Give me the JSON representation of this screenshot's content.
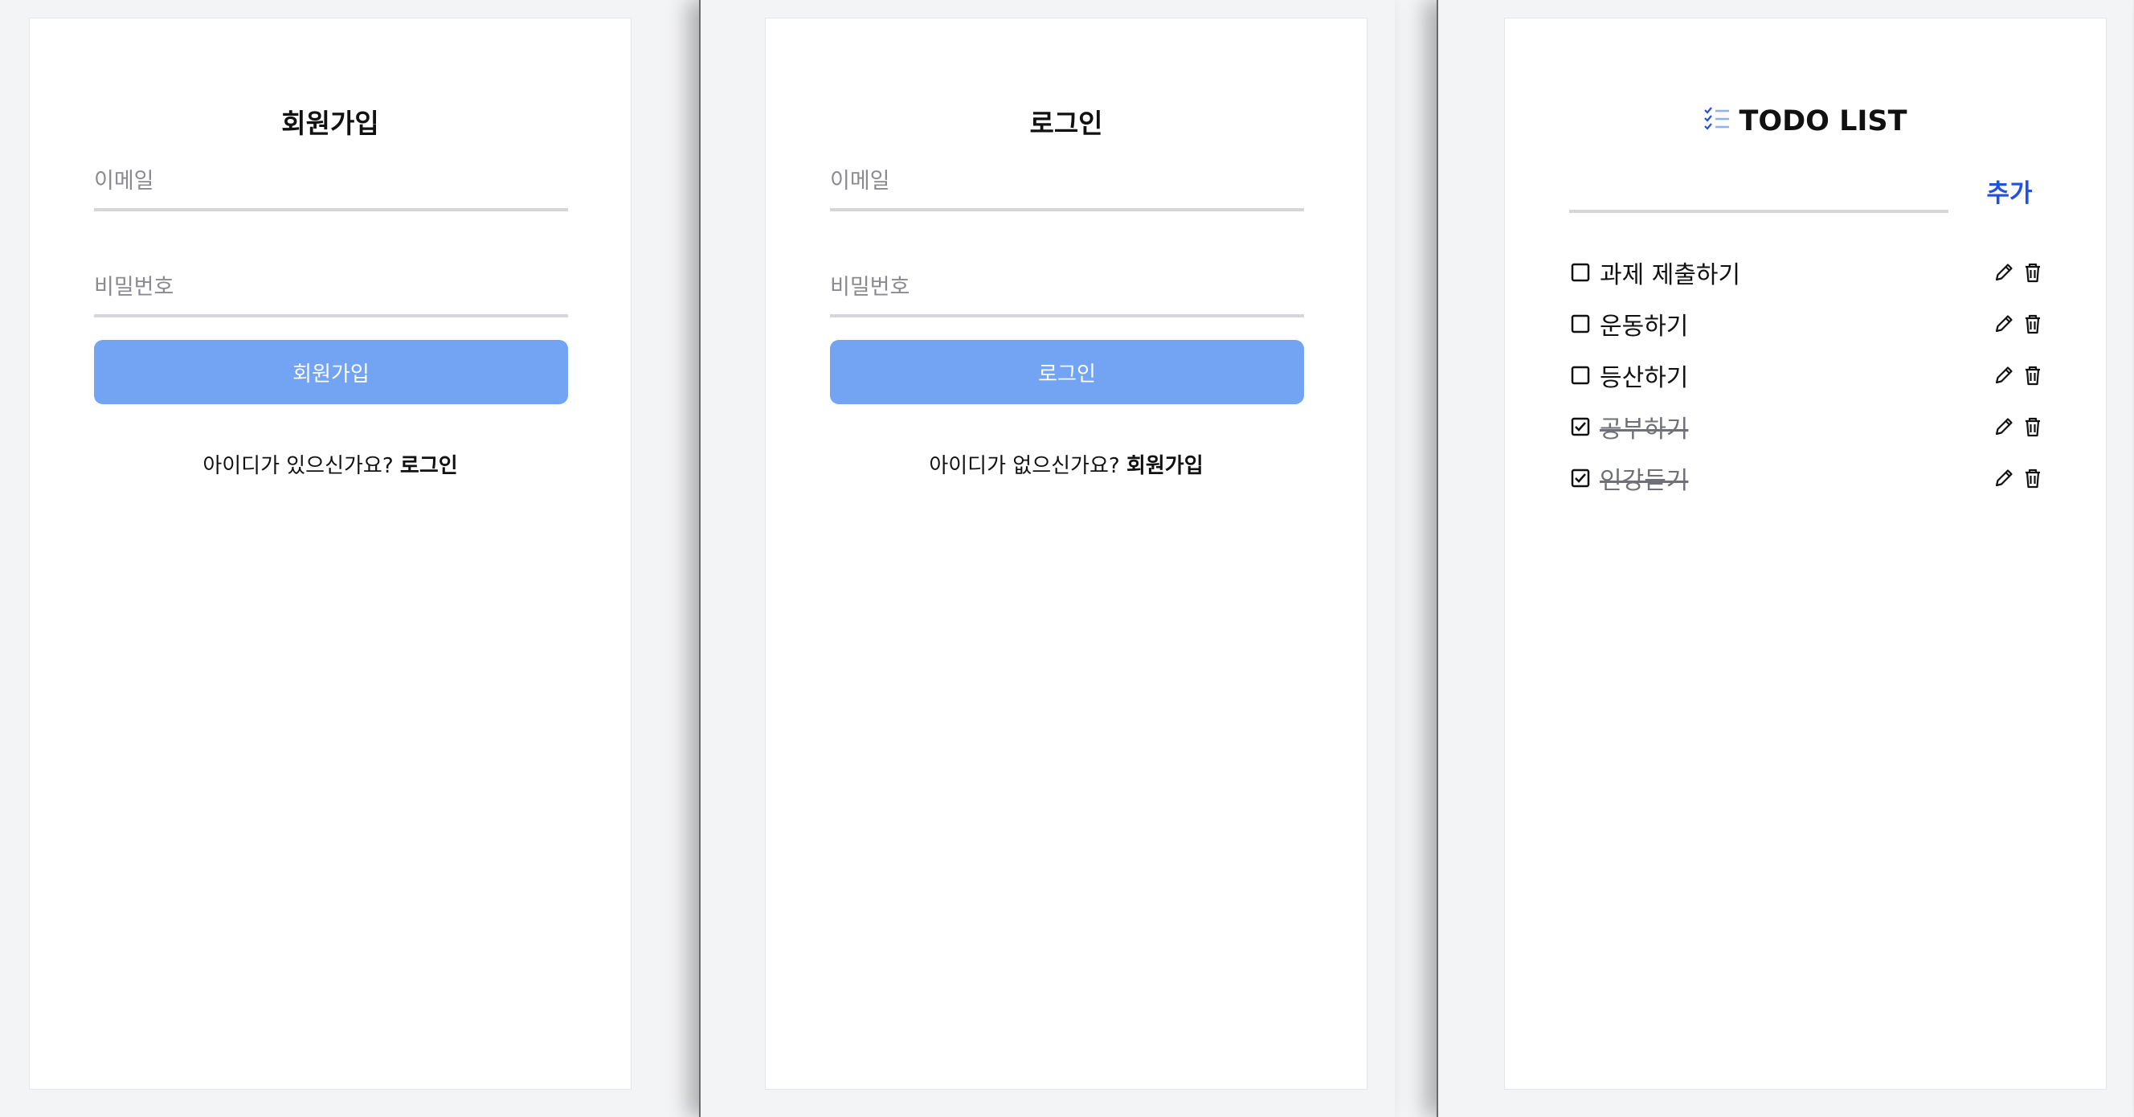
{
  "signup": {
    "title": "회원가입",
    "email_placeholder": "이메일",
    "password_placeholder": "비밀번호",
    "submit_label": "회원가입",
    "switch_prompt": "아이디가 있으신가요? ",
    "switch_link": "로그인"
  },
  "login": {
    "title": "로그인",
    "email_placeholder": "이메일",
    "password_placeholder": "비밀번호",
    "submit_label": "로그인",
    "switch_prompt": "아이디가 없으신가요? ",
    "switch_link": "회원가입"
  },
  "todo": {
    "title": "TODO LIST",
    "title_icon": "checklist-icon",
    "input_value": "",
    "add_label": "추가",
    "items": [
      {
        "text": "과제 제출하기",
        "done": false
      },
      {
        "text": "운동하기",
        "done": false
      },
      {
        "text": "등산하기",
        "done": false
      },
      {
        "text": "공부하기",
        "done": true
      },
      {
        "text": "인강듣기",
        "done": true
      }
    ]
  },
  "colors": {
    "primary_button": "#73a3f3",
    "accent_link": "#2250e0",
    "background": "#f3f4f5"
  }
}
